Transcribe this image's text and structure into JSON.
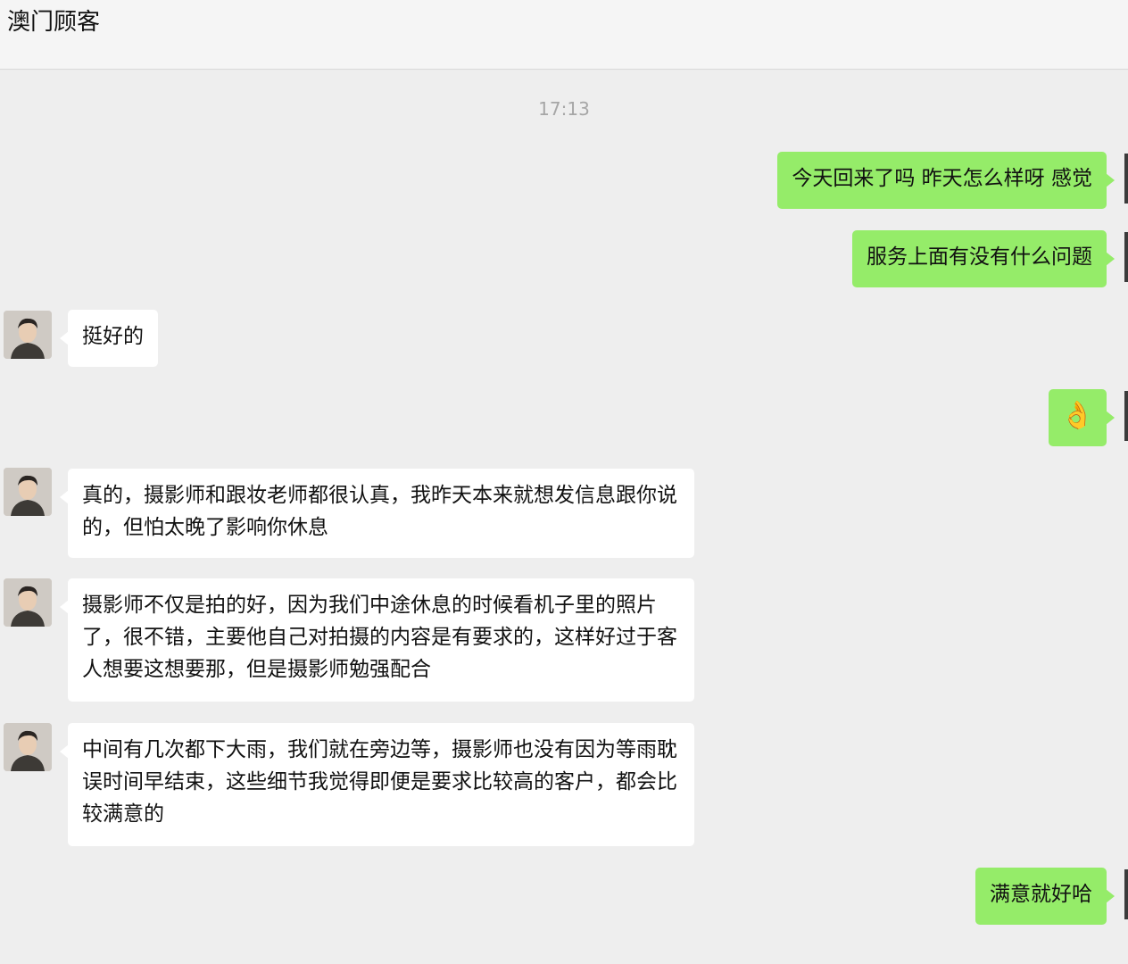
{
  "header": {
    "title": "澳门顾客"
  },
  "chat": {
    "timestamp": "17:13",
    "messages": [
      {
        "from": "me",
        "text": "今天回来了吗 昨天怎么样呀 感觉"
      },
      {
        "from": "me",
        "text": "服务上面有没有什么问题"
      },
      {
        "from": "other",
        "text": "挺好的"
      },
      {
        "from": "me",
        "text": "👌"
      },
      {
        "from": "other",
        "text": "真的，摄影师和跟妆老师都很认真，我昨天本来就想发信息跟你说的，但怕太晚了影响你休息"
      },
      {
        "from": "other",
        "text": "摄影师不仅是拍的好，因为我们中途休息的时候看机子里的照片了，很不错，主要他自己对拍摄的内容是有要求的，这样好过于客人想要这想要那，但是摄影师勉强配合"
      },
      {
        "from": "other",
        "text": "中间有几次都下大雨，我们就在旁边等，摄影师也没有因为等雨耽误时间早结束，这些细节我觉得即便是要求比较高的客户，都会比较满意的"
      },
      {
        "from": "me",
        "text": "满意就好哈"
      }
    ]
  },
  "colors": {
    "my_bubble": "#95ec69",
    "other_bubble": "#ffffff",
    "background": "#eeeeee"
  }
}
